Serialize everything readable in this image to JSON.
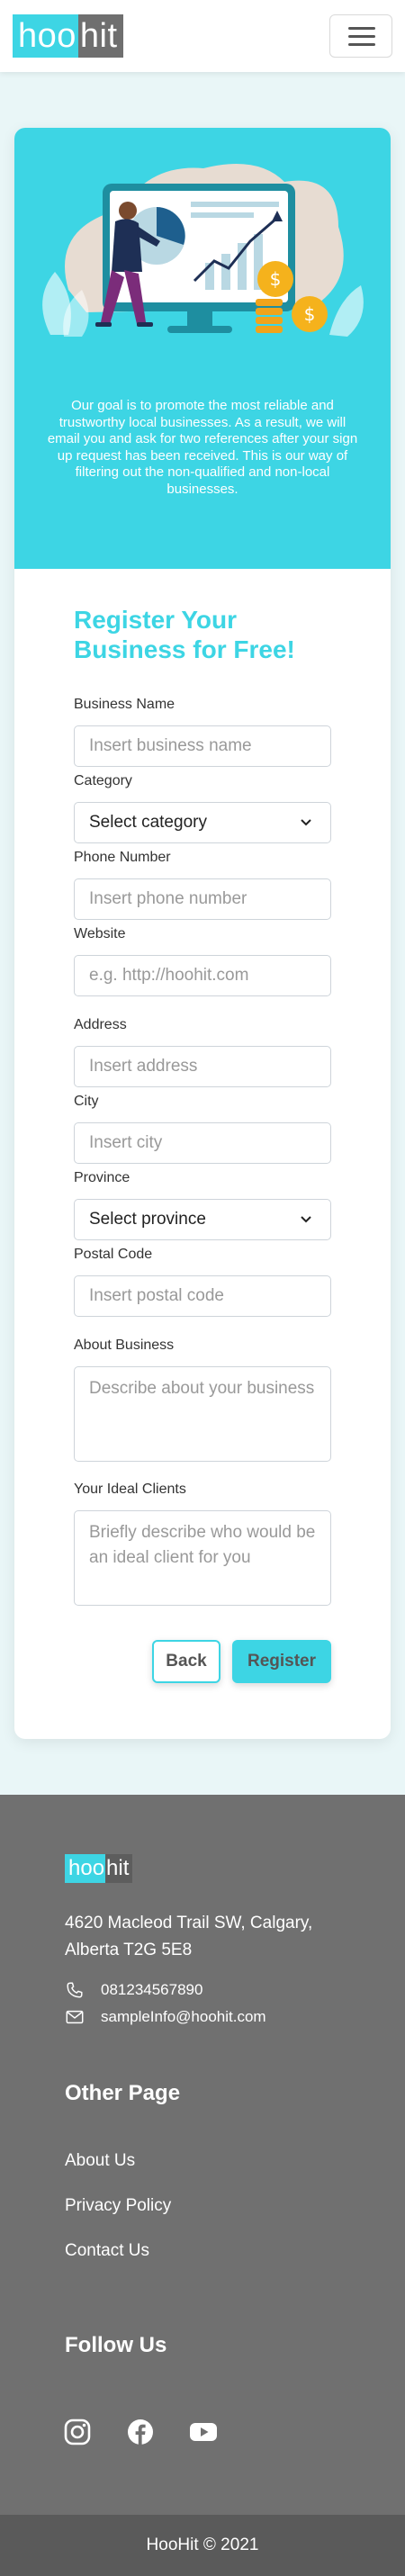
{
  "brand": {
    "logo_part1": "hoo",
    "logo_part2": "hit",
    "accent_color": "#3dd5e4",
    "logo_dark_color": "#6f6f6f"
  },
  "navbar": {
    "menu_icon": "hamburger-menu-icon"
  },
  "hero": {
    "illustration": "business-growth-illustration",
    "description": "Our goal is to promote the most reliable and trustworthy local businesses. As a result, we will email you and ask for two references after your sign up request has been received. This is our way of filtering out the non-qualified and non-local businesses."
  },
  "form": {
    "title": "Register Your Business for Free!",
    "fields": {
      "business_name": {
        "label": "Business Name",
        "placeholder": "Insert business name"
      },
      "category": {
        "label": "Category",
        "value": "Select category"
      },
      "phone": {
        "label": "Phone Number",
        "placeholder": "Insert phone number"
      },
      "website": {
        "label": "Website",
        "placeholder": "e.g. http://hoohit.com"
      },
      "address": {
        "label": "Address",
        "placeholder": "Insert address"
      },
      "city": {
        "label": "City",
        "placeholder": "Insert city"
      },
      "province": {
        "label": "Province",
        "value": "Select province"
      },
      "postal_code": {
        "label": "Postal Code",
        "placeholder": "Insert postal code"
      },
      "about": {
        "label": "About Business",
        "placeholder": "Describe about your business"
      },
      "ideal_clients": {
        "label": "Your Ideal Clients",
        "placeholder": "Briefly describe who would be an ideal client for you"
      }
    },
    "back_label": "Back",
    "register_label": "Register"
  },
  "footer": {
    "logo_part1": "hoo",
    "logo_part2": "hit",
    "address": "4620 Macleod Trail SW, Calgary, Alberta T2G 5E8",
    "phone": "081234567890",
    "email": "sampleInfo@hoohit.com",
    "other_heading": "Other Page",
    "links": [
      "About Us",
      "Privacy Policy",
      "Contact Us"
    ],
    "follow_heading": "Follow Us",
    "social_icons": [
      "instagram-icon",
      "facebook-icon",
      "youtube-icon"
    ],
    "copyright": "HooHit © 2021"
  }
}
